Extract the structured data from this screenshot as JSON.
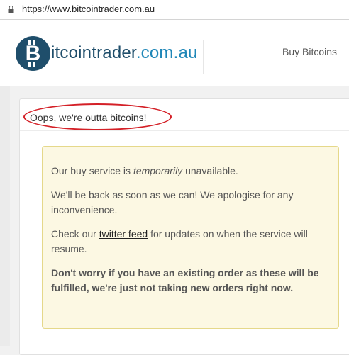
{
  "browser": {
    "url": "https://www.bitcointrader.com.au"
  },
  "header": {
    "logo_letter": "B",
    "logo_name": "itcointrader",
    "logo_domain": ".com.au",
    "nav_buy": "Buy Bitcoins"
  },
  "panel": {
    "title": "Oops, we're outta bitcoins!"
  },
  "notice": {
    "line1_pre": "Our buy service is ",
    "line1_em": "temporarily",
    "line1_post": " unavailable.",
    "line2": "We'll be back as soon as we can! We apologise for any inconvenience.",
    "line3_pre": "Check our ",
    "line3_link": "twitter feed",
    "line3_post": " for updates on when the service will resume.",
    "line4": "Don't worry if you have an existing order as these will be fulfilled, we're just not taking new orders right now."
  },
  "colors": {
    "brand_dark": "#1f4e6b",
    "brand_light": "#1f87b8",
    "highlight_circle": "#d42027",
    "notice_bg": "#fcf8e3"
  }
}
